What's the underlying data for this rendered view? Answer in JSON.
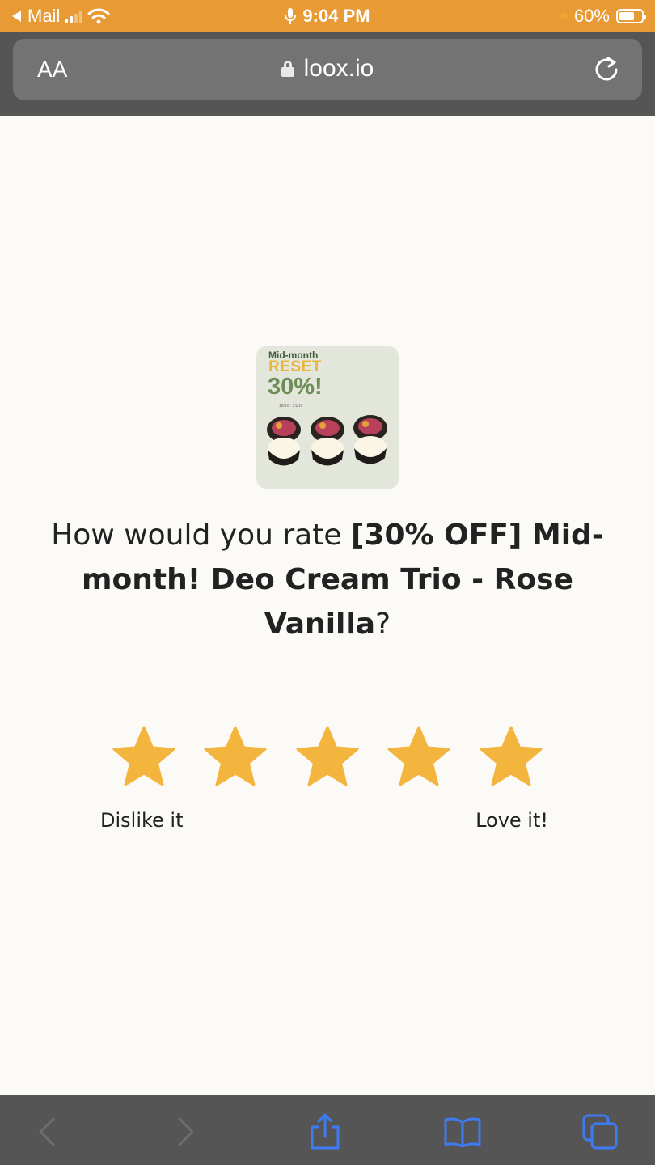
{
  "status_bar": {
    "back_app": "Mail",
    "time": "9:04 PM",
    "battery": "60%",
    "battery_level": 0.6
  },
  "address_bar": {
    "text_size_label": "AA",
    "domain": "loox.io"
  },
  "product": {
    "image_lines": [
      "Mid-month",
      "RESET",
      "30%!",
      "18/10 - 21/10"
    ]
  },
  "question": {
    "prefix": "How would you rate ",
    "product_name": "[30% OFF] Mid-month! Deo Cream Trio - Rose Vanilla",
    "suffix": "?"
  },
  "rating": {
    "star_count": 5,
    "star_color": "#f4b53f",
    "low_label": "Dislike it",
    "high_label": "Love it!"
  },
  "colors": {
    "status_bar": "#e89a35",
    "chrome": "#555555",
    "page_background": "#fbfaf6",
    "toolbar_icons": "#3d7bf5"
  }
}
